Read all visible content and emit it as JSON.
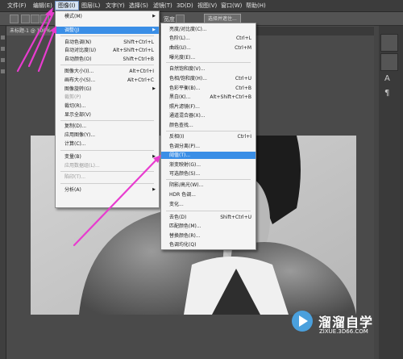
{
  "menubar": {
    "items": [
      "文件(F)",
      "编辑(E)",
      "图像(I)",
      "图层(L)",
      "文字(Y)",
      "选择(S)",
      "滤镜(T)",
      "3D(D)",
      "视图(V)",
      "窗口(W)",
      "帮助(H)"
    ],
    "active_index": 2
  },
  "optbar": {
    "width_label": "宽度",
    "select_text": "选择并遮住..."
  },
  "tab": {
    "title": "未标题-1 @ 100%"
  },
  "image_menu": {
    "items": [
      {
        "label": "模式(M)",
        "shortcut": "",
        "submenu": true,
        "disabled": false
      },
      {
        "label": "调整(J)",
        "shortcut": "",
        "submenu": true,
        "disabled": false,
        "highlight": true
      },
      {
        "label": "自动色调(N)",
        "shortcut": "Shift+Ctrl+L",
        "submenu": false,
        "disabled": false
      },
      {
        "label": "自动对比度(U)",
        "shortcut": "Alt+Shift+Ctrl+L",
        "submenu": false,
        "disabled": false
      },
      {
        "label": "自动颜色(O)",
        "shortcut": "Shift+Ctrl+B",
        "submenu": false,
        "disabled": false
      },
      {
        "label": "图像大小(I)...",
        "shortcut": "Alt+Ctrl+I",
        "submenu": false,
        "disabled": false
      },
      {
        "label": "画布大小(S)...",
        "shortcut": "Alt+Ctrl+C",
        "submenu": false,
        "disabled": false
      },
      {
        "label": "图像旋转(G)",
        "shortcut": "",
        "submenu": true,
        "disabled": false
      },
      {
        "label": "裁剪(P)",
        "shortcut": "",
        "submenu": false,
        "disabled": true
      },
      {
        "label": "裁切(R)...",
        "shortcut": "",
        "submenu": false,
        "disabled": false
      },
      {
        "label": "显示全部(V)",
        "shortcut": "",
        "submenu": false,
        "disabled": false
      },
      {
        "label": "复制(D)...",
        "shortcut": "",
        "submenu": false,
        "disabled": false
      },
      {
        "label": "应用图像(Y)...",
        "shortcut": "",
        "submenu": false,
        "disabled": false
      },
      {
        "label": "计算(C)...",
        "shortcut": "",
        "submenu": false,
        "disabled": false
      },
      {
        "label": "变量(B)",
        "shortcut": "",
        "submenu": true,
        "disabled": false
      },
      {
        "label": "应用数据组(L)...",
        "shortcut": "",
        "submenu": false,
        "disabled": true
      },
      {
        "label": "陷印(T)...",
        "shortcut": "",
        "submenu": false,
        "disabled": true
      },
      {
        "label": "分析(A)",
        "shortcut": "",
        "submenu": true,
        "disabled": false
      }
    ]
  },
  "adjust_menu": {
    "items": [
      {
        "label": "亮度/对比度(C)...",
        "shortcut": ""
      },
      {
        "label": "色阶(L)...",
        "shortcut": "Ctrl+L"
      },
      {
        "label": "曲线(U)...",
        "shortcut": "Ctrl+M"
      },
      {
        "label": "曝光度(E)...",
        "shortcut": ""
      },
      {
        "label": "自然饱和度(V)...",
        "shortcut": ""
      },
      {
        "label": "色相/饱和度(H)...",
        "shortcut": "Ctrl+U"
      },
      {
        "label": "色彩平衡(B)...",
        "shortcut": "Ctrl+B"
      },
      {
        "label": "黑白(K)...",
        "shortcut": "Alt+Shift+Ctrl+B"
      },
      {
        "label": "照片滤镜(F)...",
        "shortcut": ""
      },
      {
        "label": "通道混合器(X)...",
        "shortcut": ""
      },
      {
        "label": "颜色查找...",
        "shortcut": ""
      },
      {
        "label": "反相(I)",
        "shortcut": "Ctrl+I"
      },
      {
        "label": "色调分离(P)...",
        "shortcut": ""
      },
      {
        "label": "阈值(T)...",
        "shortcut": "",
        "highlight": true
      },
      {
        "label": "渐变映射(G)...",
        "shortcut": ""
      },
      {
        "label": "可选颜色(S)...",
        "shortcut": ""
      },
      {
        "label": "阴影/高光(W)...",
        "shortcut": ""
      },
      {
        "label": "HDR 色调...",
        "shortcut": ""
      },
      {
        "label": "变化...",
        "shortcut": ""
      },
      {
        "label": "去色(D)",
        "shortcut": "Shift+Ctrl+U"
      },
      {
        "label": "匹配颜色(M)...",
        "shortcut": ""
      },
      {
        "label": "替换颜色(R)...",
        "shortcut": ""
      },
      {
        "label": "色调均化(Q)",
        "shortcut": ""
      }
    ]
  },
  "watermark": {
    "title": "溜溜自学",
    "url": "ZIXUE.3D66.COM"
  },
  "colors": {
    "highlight": "#3a8ee6",
    "annotation_arrow": "#e83ccf"
  }
}
